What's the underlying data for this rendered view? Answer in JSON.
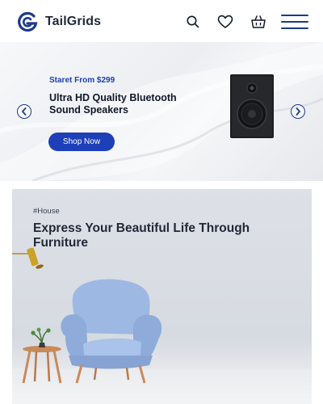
{
  "header": {
    "brand": "TailGrids",
    "icons": [
      "search-icon",
      "heart-icon",
      "basket-icon",
      "menu-icon"
    ],
    "brand_color": "#1e3a8a"
  },
  "hero": {
    "kicker": "Staret From $299",
    "title": "Ultra HD Quality Bluetooth Sound Speakers",
    "cta": "Shop Now",
    "accent": "#1d3fb8"
  },
  "promo": {
    "tag": "#House",
    "title": "Express Your Beautiful Life Through Furniture"
  }
}
